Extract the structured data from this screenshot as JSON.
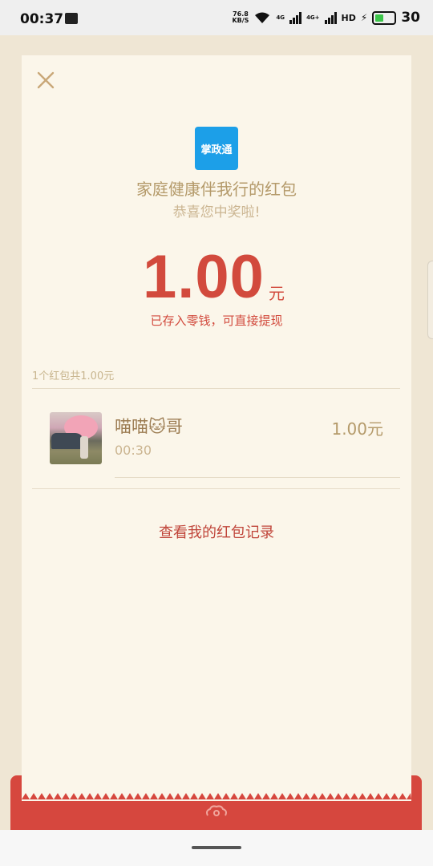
{
  "status_bar": {
    "time": "00:37",
    "net_speed_value": "76.8",
    "net_speed_unit": "KB/S",
    "network_4g": "4G",
    "network_4g_plus": "4G+",
    "hd_label": "HD",
    "battery_level": "30"
  },
  "packet": {
    "app_logo_text": "掌政通",
    "sender_title": "家庭健康伴我行的红包",
    "congrats": "恭喜您中奖啦!",
    "amount": "1.00",
    "unit": "元",
    "saved_note": "已存入零钱，可直接提现"
  },
  "summary": "1个红包共1.00元",
  "recipients": [
    {
      "nickname": "喵喵🐱哥",
      "time": "00:30",
      "amount": "1.00元"
    }
  ],
  "records_link": "查看我的红包记录",
  "colors": {
    "accent_red": "#d24a3d",
    "card_bg": "#fbf6ea",
    "gold_text": "#b49a6a"
  }
}
